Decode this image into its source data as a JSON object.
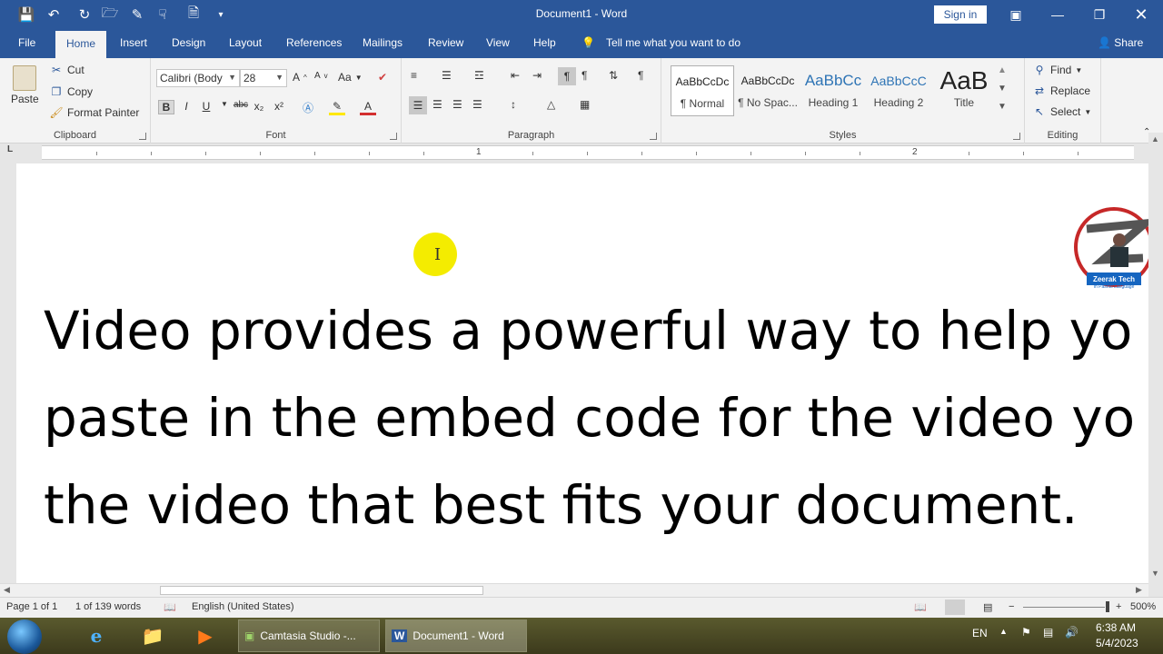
{
  "app": {
    "title": "Document1 - Word",
    "sign_in": "Sign in"
  },
  "colors": {
    "accent": "#2b579a",
    "highlight": "#f4ec00"
  },
  "quick_access": [
    "save-icon",
    "undo-icon",
    "redo-icon",
    "open-icon",
    "form-icon",
    "touch-mode-icon",
    "new-doc-icon",
    "customize-icon"
  ],
  "tabs": [
    "File",
    "Home",
    "Insert",
    "Design",
    "Layout",
    "References",
    "Mailings",
    "Review",
    "View",
    "Help"
  ],
  "active_tab": "Home",
  "tell_me": "Tell me what you want to do",
  "share": "Share",
  "clipboard": {
    "paste": "Paste",
    "cut": "Cut",
    "copy": "Copy",
    "format_painter": "Format Painter",
    "label": "Clipboard"
  },
  "font": {
    "name": "Calibri (Body",
    "size": "28",
    "case_label": "Aa",
    "label": "Font",
    "buttons": [
      "B",
      "I",
      "U",
      "abc",
      "x₂",
      "x²"
    ]
  },
  "paragraph": {
    "label": "Paragraph"
  },
  "styles": {
    "label": "Styles",
    "items": [
      {
        "sample": "AaBbCcDc",
        "name": "¶ Normal"
      },
      {
        "sample": "AaBbCcDc",
        "name": "¶ No Spac..."
      },
      {
        "sample": "AaBbCc",
        "name": "Heading 1"
      },
      {
        "sample": "AaBbCcC",
        "name": "Heading 2"
      },
      {
        "sample": "AaB",
        "name": "Title"
      }
    ]
  },
  "editing": {
    "find": "Find",
    "replace": "Replace",
    "select": "Select",
    "label": "Editing"
  },
  "ruler": {
    "marks": [
      "1",
      "2"
    ]
  },
  "document": {
    "lines": [
      "Video provides a powerful way to help yo",
      "paste in the embed code for the video yo",
      "the video that best fits your document."
    ]
  },
  "logo": {
    "brand": "Zeerak Tech",
    "tagline": "In Pashto Language"
  },
  "status": {
    "page": "Page 1 of 1",
    "words": "1 of 139 words",
    "language": "English (United States)",
    "zoom": "500%"
  },
  "taskbar": {
    "tasks": [
      "Camtasia Studio -...",
      "Document1 - Word"
    ],
    "lang": "EN",
    "time": "6:38 AM",
    "date": "5/4/2023"
  }
}
